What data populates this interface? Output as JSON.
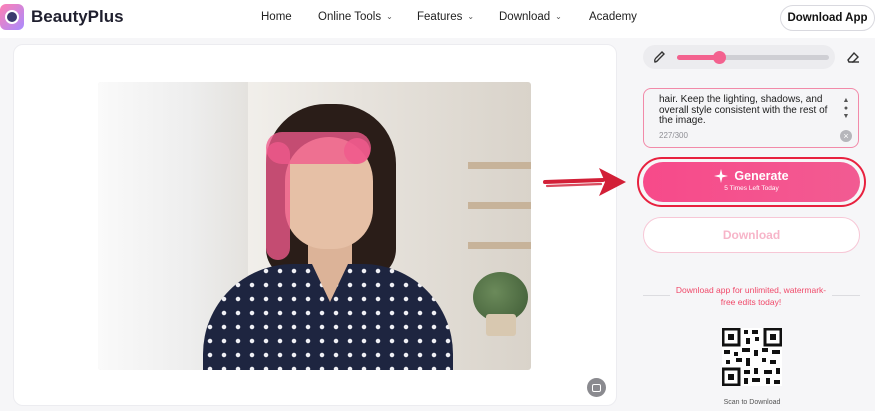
{
  "brand": {
    "name": "BeautyPlus"
  },
  "nav": {
    "items": [
      {
        "label": "Home",
        "has_dropdown": false
      },
      {
        "label": "Online Tools",
        "has_dropdown": true
      },
      {
        "label": "Features",
        "has_dropdown": true
      },
      {
        "label": "Download",
        "has_dropdown": true
      },
      {
        "label": "Academy",
        "has_dropdown": false
      }
    ],
    "download_app_label": "Download App",
    "chevron": "⌄"
  },
  "editor": {
    "brush_size_fraction": 0.28,
    "prompt": {
      "text": "hair. Keep the lighting, shadows, and overall style consistent with the rest of the image.",
      "count": "227/300"
    },
    "generate": {
      "label": "Generate",
      "sublabel": "5 Times Left Today"
    },
    "download_label": "Download",
    "promo": "Download app for unlimited, watermark-free edits today!",
    "qr_caption": "Scan to Download"
  },
  "colors": {
    "accent": "#f74a8a",
    "highlight_outline": "#e8213f",
    "mask": "#f05a8c"
  },
  "icons": {
    "brush": "brush-icon",
    "eraser": "eraser-icon",
    "sparkle": "sparkle-icon",
    "compare": "compare-icon",
    "clear": "clear-icon"
  }
}
